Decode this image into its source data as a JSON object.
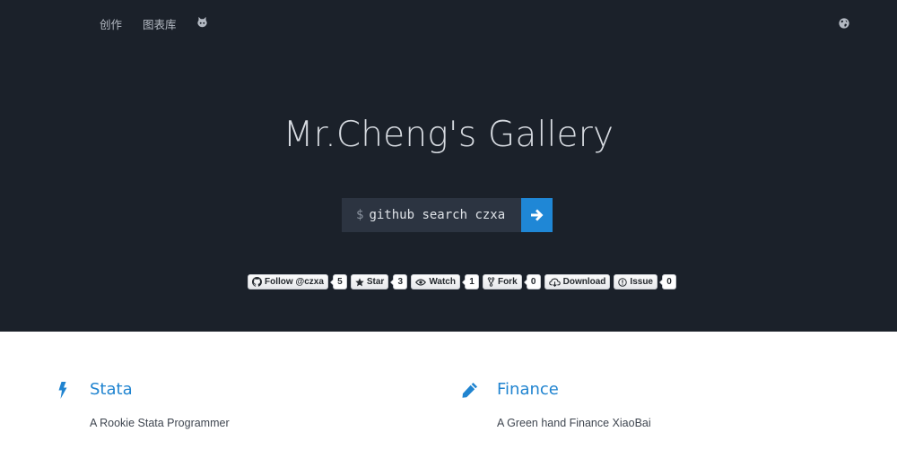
{
  "nav": {
    "items": [
      "创作",
      "图表库"
    ],
    "github_icon": "github-octocat-icon",
    "globe_icon": "globe-icon"
  },
  "hero": {
    "title": "Mr.Cheng's Gallery",
    "command_prompt": "$",
    "command_text": "github search czxa",
    "go_icon": "arrow-right-icon"
  },
  "badges": [
    {
      "icon": "github-icon",
      "label": "Follow @czxa",
      "count": "5"
    },
    {
      "icon": "star-icon",
      "label": "Star",
      "count": "3"
    },
    {
      "icon": "eye-icon",
      "label": "Watch",
      "count": "1"
    },
    {
      "icon": "fork-icon",
      "label": "Fork",
      "count": "0"
    },
    {
      "icon": "cloud-download-icon",
      "label": "Download",
      "count": null
    },
    {
      "icon": "issue-icon",
      "label": "Issue",
      "count": "0"
    }
  ],
  "features": [
    {
      "icon": "lightning-icon",
      "title": "Stata",
      "description": "A Rookie Stata Programmer"
    },
    {
      "icon": "pencil-icon",
      "title": "Finance",
      "description": "A Green hand Finance XiaoBai"
    }
  ],
  "colors": {
    "hero_background": "#1b212a",
    "accent": "#1f87d6",
    "link": "#2084d0"
  }
}
